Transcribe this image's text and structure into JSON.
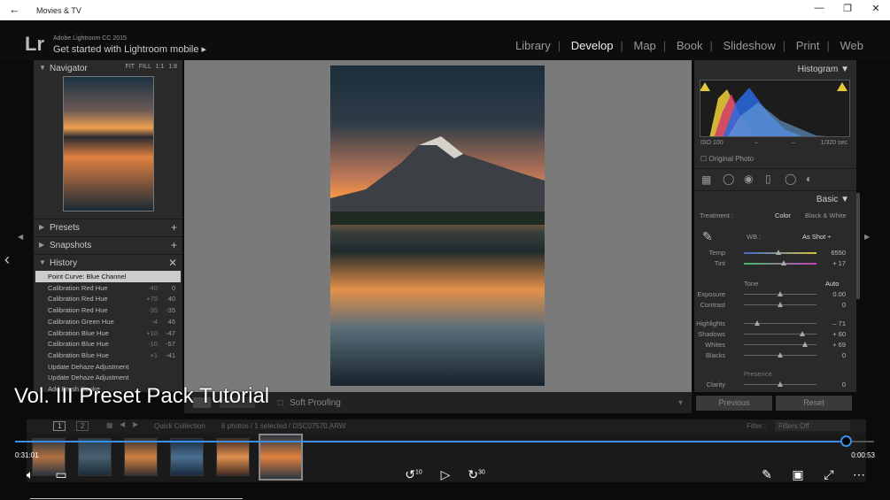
{
  "window": {
    "title": "Movies & TV"
  },
  "lightroom": {
    "logo": "Lr",
    "product": "Adobe Lightroom CC 2015",
    "mobile_prompt": "Get started with Lightroom mobile",
    "modules": [
      "Library",
      "Develop",
      "Map",
      "Book",
      "Slideshow",
      "Print",
      "Web"
    ],
    "active_module": "Develop"
  },
  "left_panel": {
    "navigator": {
      "title": "Navigator",
      "options": [
        "FIT",
        "FILL",
        "1:1",
        "1:8"
      ]
    },
    "presets": "Presets",
    "snapshots": "Snapshots",
    "history": {
      "title": "History",
      "items": [
        {
          "name": "Point Curve: Blue Channel",
          "a": "",
          "b": ""
        },
        {
          "name": "Calibration Red Hue",
          "a": "-40",
          "b": "0"
        },
        {
          "name": "Calibration Red Hue",
          "a": "+75",
          "b": "40"
        },
        {
          "name": "Calibration Red Hue",
          "a": "-35",
          "b": "-35"
        },
        {
          "name": "Calibration Green Hue",
          "a": "-4",
          "b": "46"
        },
        {
          "name": "Calibration Blue Hue",
          "a": "+10",
          "b": "-47"
        },
        {
          "name": "Calibration Blue Hue",
          "a": "-10",
          "b": "-57"
        },
        {
          "name": "Calibration Blue Hue",
          "a": "+1",
          "b": "-41"
        },
        {
          "name": "Update Dehaze Adjustment",
          "a": "",
          "b": ""
        },
        {
          "name": "Update Dehaze Adjustment",
          "a": "",
          "b": ""
        },
        {
          "name": "Add Brush Stroke",
          "a": "",
          "b": ""
        }
      ]
    }
  },
  "right_panel": {
    "histogram_title": "Histogram",
    "iso": "ISO 100",
    "dash1": "–",
    "dash2": "–",
    "shutter": "1/320 sec",
    "original_photo": "Original Photo",
    "basic_title": "Basic",
    "treatment_label": "Treatment :",
    "treatment_color": "Color",
    "treatment_bw": "Black & White",
    "wb_label": "WB :",
    "wb_value": "As Shot ÷",
    "tone_label": "Tone",
    "auto_label": "Auto",
    "presence_label": "Presence",
    "sliders_wb": [
      {
        "label": "Temp",
        "value": "6550",
        "pos": 0.47
      },
      {
        "label": "Tint",
        "value": "+ 17",
        "pos": 0.55
      }
    ],
    "sliders_tone": [
      {
        "label": "Exposure",
        "value": "0.00",
        "pos": 0.5
      },
      {
        "label": "Contrast",
        "value": "0",
        "pos": 0.5
      }
    ],
    "sliders_tone2": [
      {
        "label": "Highlights",
        "value": "– 71",
        "pos": 0.18
      },
      {
        "label": "Shadows",
        "value": "+ 60",
        "pos": 0.8
      },
      {
        "label": "Whites",
        "value": "+ 69",
        "pos": 0.84
      },
      {
        "label": "Blacks",
        "value": "0",
        "pos": 0.5
      }
    ],
    "sliders_presence": [
      {
        "label": "Clarity",
        "value": "0",
        "pos": 0.5
      }
    ],
    "previous": "Previous",
    "reset": "Reset"
  },
  "toolbar": {
    "soft_proofing": "Soft Proofing"
  },
  "filmstrip": {
    "view1": "1",
    "view2": "2",
    "collection": "Quick Collection",
    "info": "6 photos / 1 selected / DSC07570.ARW",
    "filter_label": "Filter :",
    "filter_value": "Filters Off"
  },
  "video": {
    "title": "Vol. III Preset Pack Tutorial",
    "elapsed": "0:31:01",
    "remaining": "0:00:53",
    "progress": 0.967,
    "skip_back": "10",
    "skip_fwd": "30"
  }
}
